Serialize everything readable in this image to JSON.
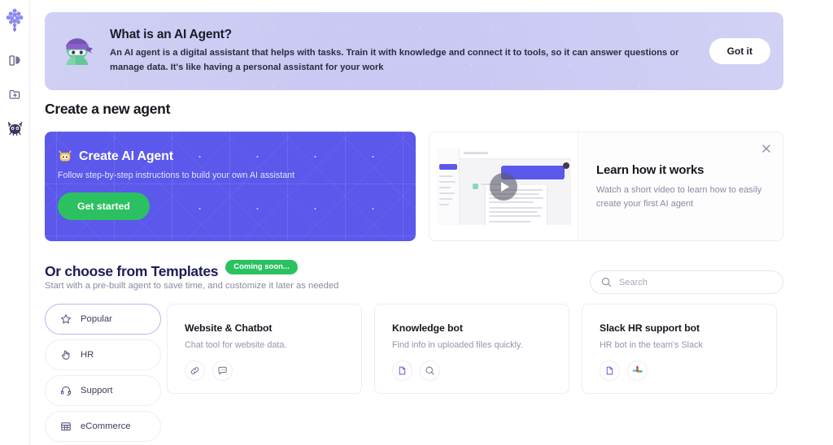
{
  "sidebar": {
    "items": [
      {
        "name": "logo",
        "icon": "grape-logo-icon",
        "label": ""
      },
      {
        "name": "library",
        "icon": "book-pages-icon",
        "label": ""
      },
      {
        "name": "new-folder",
        "icon": "folder-plus-icon",
        "label": ""
      },
      {
        "name": "agent",
        "icon": "robot-mask-icon",
        "label": ""
      }
    ]
  },
  "banner": {
    "mascot_icon": "ninja-mascot-icon",
    "title": "What is an AI Agent?",
    "body": "An AI agent is a digital assistant that helps with tasks. Train it with knowledge and connect it to tools, so it can answer questions or manage data. It's like having a personal assistant for your work",
    "dismiss_label": "Got it",
    "bg_color": "#c9c9f3"
  },
  "create_section": {
    "heading": "Create a new agent",
    "card": {
      "icon": "robot-head-icon",
      "title": "Create AI Agent",
      "subtitle": "Follow step-by-step instructions to build your own AI assistant",
      "button_label": "Get started",
      "bg_color": "#5b58eb",
      "button_color": "#2bc161"
    },
    "video": {
      "title": "Learn how it works",
      "subtitle": "Watch a short video to learn how to easily create your first AI agent",
      "play_icon": "play-button-icon",
      "close_icon": "close-icon"
    }
  },
  "templates_section": {
    "heading": "Or choose from Templates",
    "badge": "Coming soon...",
    "badge_color": "#2bc161",
    "subtitle": "Start with a pre-built agent to save time, and customize it later as needed",
    "search": {
      "placeholder": "Search",
      "value": "",
      "icon": "search-icon"
    },
    "categories": [
      {
        "label": "Popular",
        "icon": "star-icon",
        "active": true
      },
      {
        "label": "HR",
        "icon": "hand-icon",
        "active": false
      },
      {
        "label": "Support",
        "icon": "headset-icon",
        "active": false
      },
      {
        "label": "eCommerce",
        "icon": "store-icon",
        "active": false
      }
    ],
    "cards": [
      {
        "title": "Website & Chatbot",
        "subtitle": "Chat tool for website data.",
        "icons": [
          "link-icon",
          "chat-bubble-icon"
        ]
      },
      {
        "title": "Knowledge bot",
        "subtitle": "Find info in uploaded files quickly.",
        "icons": [
          "file-icon",
          "search-icon"
        ]
      },
      {
        "title": "Slack HR support bot",
        "subtitle": "HR bot in the team's Slack",
        "icons": [
          "file-icon",
          "slack-icon"
        ]
      }
    ]
  }
}
